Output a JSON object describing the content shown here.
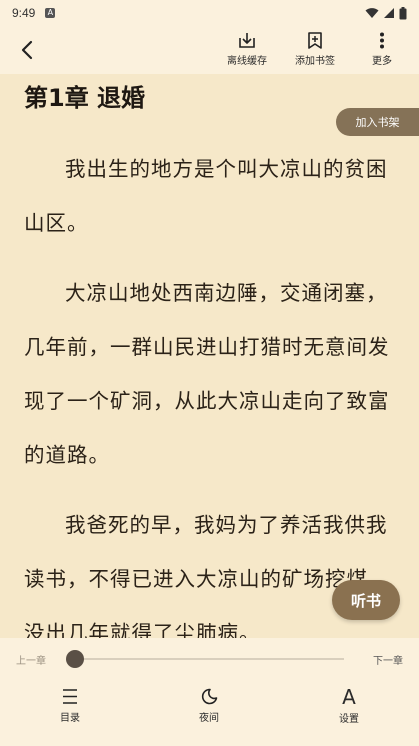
{
  "status_bar": {
    "time": "9:49",
    "notification_icon": "a-icon",
    "wifi_icon": "wifi-icon",
    "signal_icon": "signal-icon",
    "battery_icon": "battery-icon"
  },
  "toolbar": {
    "back_icon": "chevron-left-icon",
    "offline_label": "离线缓存",
    "bookmark_label": "添加书签",
    "more_label": "更多"
  },
  "chapter": {
    "title": "第1章 退婚",
    "paragraphs": [
      "我出生的地方是个叫大凉山的贫困山区。",
      "大凉山地处西南边陲，交通闭塞，几年前，一群山民进山打猎时无意间发现了一个矿洞，从此大凉山走向了致富的道路。",
      "我爸死的早，我妈为了养活我供我读书，不得已进入大凉山的矿场挖煤，没出几年就得了尘肺病。"
    ]
  },
  "add_shelf_label": "加入书架",
  "listen_label": "听书",
  "bottom": {
    "prev_label": "上一章",
    "next_label": "下一章",
    "progress": 0,
    "catalog_label": "目录",
    "night_label": "夜间",
    "settings_label": "设置",
    "settings_icon_text": "A"
  },
  "colors": {
    "page_background": "#f6e8c9",
    "panel_background": "#fbf1dd",
    "accent_brown": "#857257"
  }
}
